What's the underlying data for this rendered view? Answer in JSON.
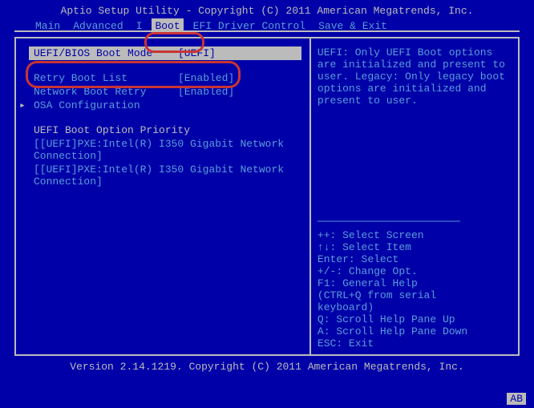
{
  "header": {
    "title": "Aptio Setup Utility - Copyright (C) 2011 American Megatrends, Inc."
  },
  "menu": {
    "items": [
      {
        "label": "Main"
      },
      {
        "label": "Advanced"
      },
      {
        "label": "I"
      },
      {
        "label": "Boot"
      },
      {
        "label": "EFI Driver Control"
      },
      {
        "label": "Save & Exit"
      }
    ]
  },
  "settings": {
    "boot_mode_label": "UEFI/BIOS Boot Mode",
    "boot_mode_value": "[UEFI]",
    "retry_list_label": "Retry Boot List",
    "retry_list_value": "[Enabled]",
    "net_retry_label": "Network Boot Retry",
    "net_retry_value": "[Enabled]",
    "osa_label": "OSA Configuration",
    "priority_heading": "UEFI Boot Option Priority",
    "boot_entry1": "[[UEFI]PXE:Intel(R) I350 Gigabit Network Connection]",
    "boot_entry2": "[[UEFI]PXE:Intel(R) I350 Gigabit Network Connection]"
  },
  "help": {
    "text": "UEFI: Only UEFI Boot options are initialized and present to user. Legacy: Only legacy boot options are initialized and present to user."
  },
  "hints": {
    "divider": "──────────────────────────",
    "l1": "++: Select Screen",
    "l2": "↑↓: Select Item",
    "l3": "Enter: Select",
    "l4": "+/-: Change Opt.",
    "l5": "F1: General Help",
    "l6": " (CTRL+Q from serial",
    "l7": "keyboard)",
    "l8": "Q: Scroll Help Pane Up",
    "l9": "A: Scroll Help Pane Down",
    "l10": "ESC: Exit"
  },
  "footer": {
    "text": "Version 2.14.1219. Copyright (C) 2011 American Megatrends, Inc."
  },
  "corner": {
    "label": "AB"
  }
}
